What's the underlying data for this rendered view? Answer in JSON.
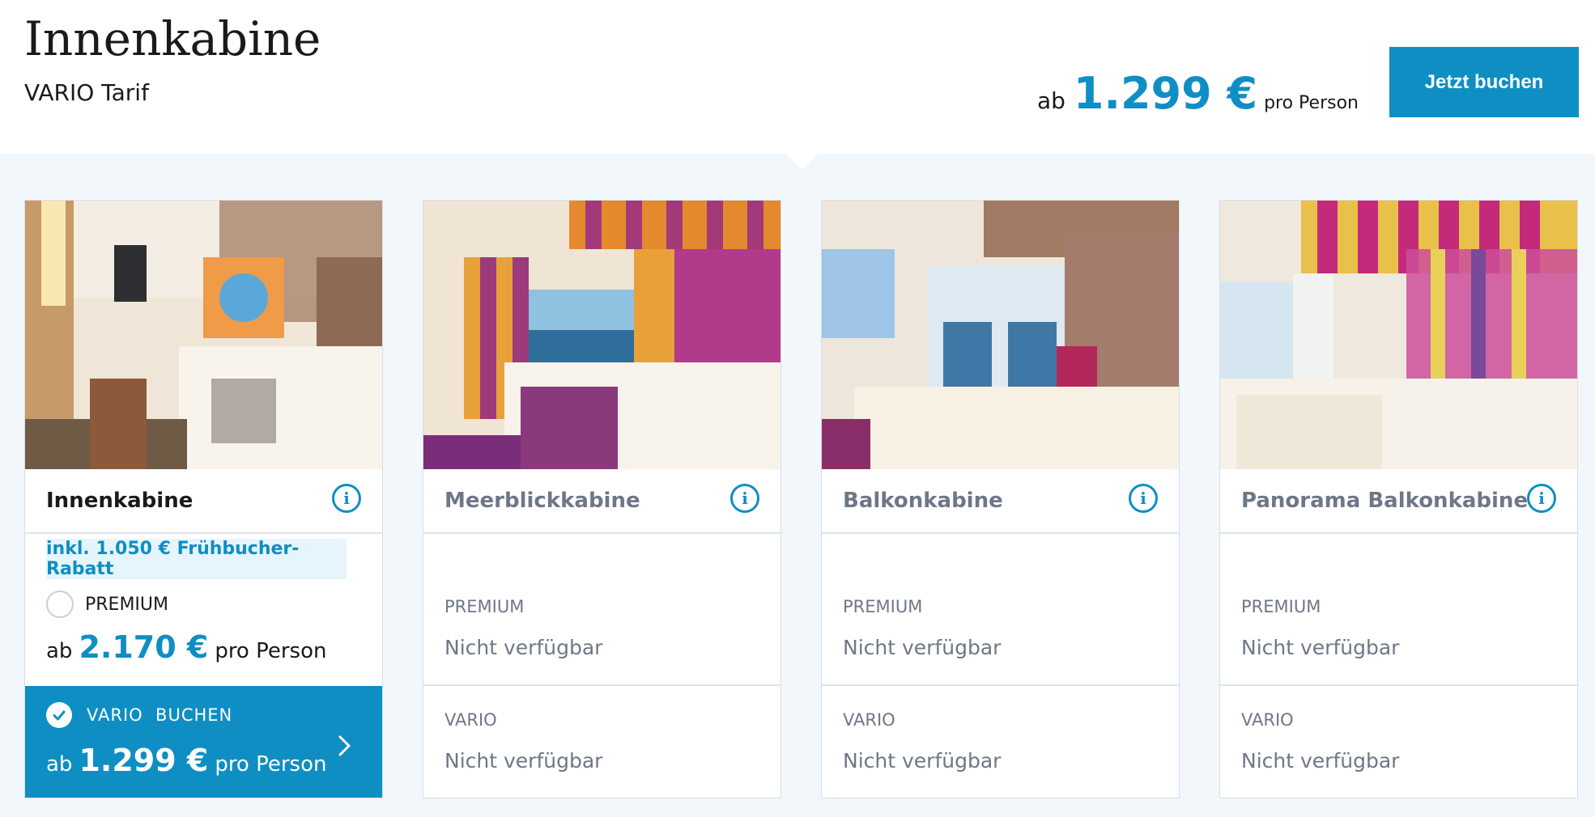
{
  "header": {
    "title": "Innenkabine",
    "subtitle": "VARIO Tarif",
    "price_prefix": "ab",
    "price": "1.299 €",
    "price_suffix": "pro Person",
    "book_label": "Jetzt buchen"
  },
  "colors": {
    "accent": "#0f8ec4",
    "band": "#f2f7fb",
    "rabatt_bg": "#e6f5fb",
    "muted": "#6e7788"
  },
  "cards": [
    {
      "name": "Innenkabine",
      "info_icon": "info-icon",
      "rabatt": "inkl. 1.050 € Frühbucher-Rabatt",
      "premium_label": "PREMIUM",
      "premium_price_prefix": "ab",
      "premium_price": "2.170 €",
      "premium_price_suffix": "pro Person",
      "vario_label": "VARIO  BUCHEN",
      "vario_price_prefix": "ab",
      "vario_price": "1.299 €",
      "vario_price_suffix": "pro Person"
    },
    {
      "name": "Meerblickkabine",
      "info_icon": "info-icon",
      "premium_label": "PREMIUM",
      "premium_value": "Nicht verfügbar",
      "vario_label": "VARIO",
      "vario_value": "Nicht verfügbar"
    },
    {
      "name": "Balkonkabine",
      "info_icon": "info-icon",
      "premium_label": "PREMIUM",
      "premium_value": "Nicht verfügbar",
      "vario_label": "VARIO",
      "vario_value": "Nicht verfügbar"
    },
    {
      "name": "Panorama Balkonkabine",
      "info_icon": "info-icon",
      "premium_label": "PREMIUM",
      "premium_value": "Nicht verfügbar",
      "vario_label": "VARIO",
      "vario_value": "Nicht verfügbar"
    }
  ]
}
